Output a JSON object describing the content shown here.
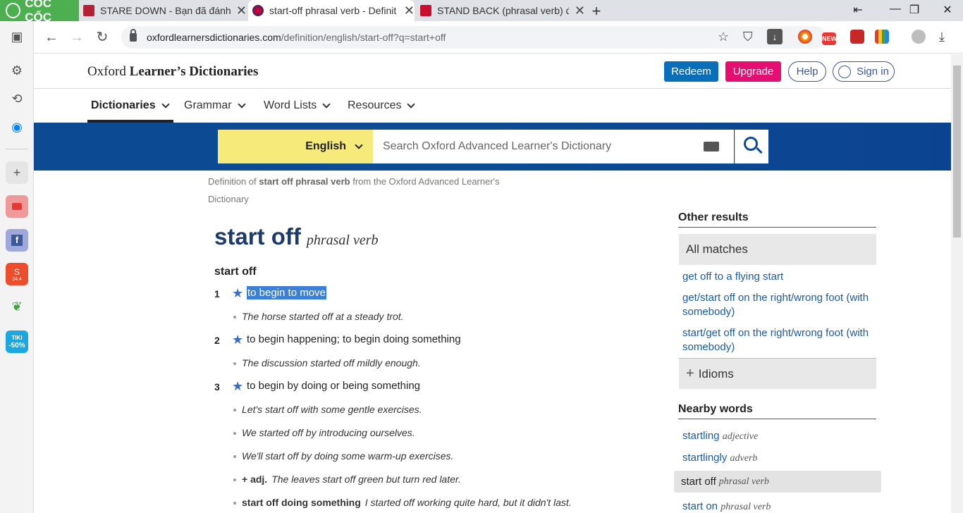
{
  "browser": {
    "brand": "CỐC CỐC",
    "tabs": [
      {
        "title": "STARE DOWN - Bạn đã đánh",
        "active": false
      },
      {
        "title": "start-off phrasal verb - Definit",
        "active": true
      },
      {
        "title": "STAND BACK (phrasal verb) đ",
        "active": false
      }
    ],
    "url_domain": "oxfordlearnersdictionaries.com",
    "url_path": "/definition/english/start-off?q=start+off",
    "ext_badge": "NEW",
    "sidebar_badges": {
      "shopee": "24.4",
      "tiki_top": "TIKI",
      "tiki_bottom": "-50%"
    }
  },
  "header": {
    "brand_light": "Oxford",
    "brand_bold": "Learner’s Dictionaries",
    "redeem": "Redeem",
    "upgrade": "Upgrade",
    "help": "Help",
    "signin": "Sign in"
  },
  "nav": {
    "items": [
      "Dictionaries",
      "Grammar",
      "Word Lists",
      "Resources"
    ]
  },
  "search": {
    "language": "English",
    "placeholder": "Search Oxford Advanced Learner's Dictionary"
  },
  "entry": {
    "definition_of_prefix": "Definition of",
    "definition_of_term": "start off phrasal verb",
    "definition_of_suffix": "from the Oxford Advanced Learner's Dictionary",
    "headword": "start off",
    "pos": "phrasal verb",
    "phrasal": "start off",
    "senses": [
      {
        "num": "1",
        "def": "to begin to move",
        "examples": [
          "The horse started off at a steady trot."
        ]
      },
      {
        "num": "2",
        "def": "to begin happening; to begin doing something",
        "examples": [
          "The discussion started off mildly enough."
        ]
      },
      {
        "num": "3",
        "def": "to begin by doing or being something",
        "examples": [
          "Let's start off with some gentle exercises.",
          "We started off by introducing ourselves.",
          "We'll start off by doing some warm-up exercises."
        ]
      }
    ],
    "extra_examples": [
      {
        "pattern": "+ adj.",
        "text": "The leaves start off green but turn red later."
      },
      {
        "pattern": "start off doing something",
        "text": "I started off working quite hard, but it didn't last."
      }
    ]
  },
  "sidebar_right": {
    "other_results_title": "Other results",
    "all_matches": "All matches",
    "links": [
      "get off to a flying start",
      "get/start off on the right/wrong foot (with somebody)",
      "start/get off on the right/wrong foot (with somebody)"
    ],
    "idioms": "Idioms",
    "nearby_title": "Nearby words",
    "nearby": [
      {
        "word": "startling",
        "pos": "adjective"
      },
      {
        "word": "startlingly",
        "pos": "adverb"
      },
      {
        "word": "start off",
        "pos": "phrasal verb"
      },
      {
        "word": "start on",
        "pos": "phrasal verb"
      }
    ]
  },
  "colors": {
    "band": "#0c4a94",
    "lang_bg": "#f5ea7a",
    "redeem": "#0b6eb8",
    "upgrade": "#e40f70",
    "highlight": "#3b7fd6"
  }
}
